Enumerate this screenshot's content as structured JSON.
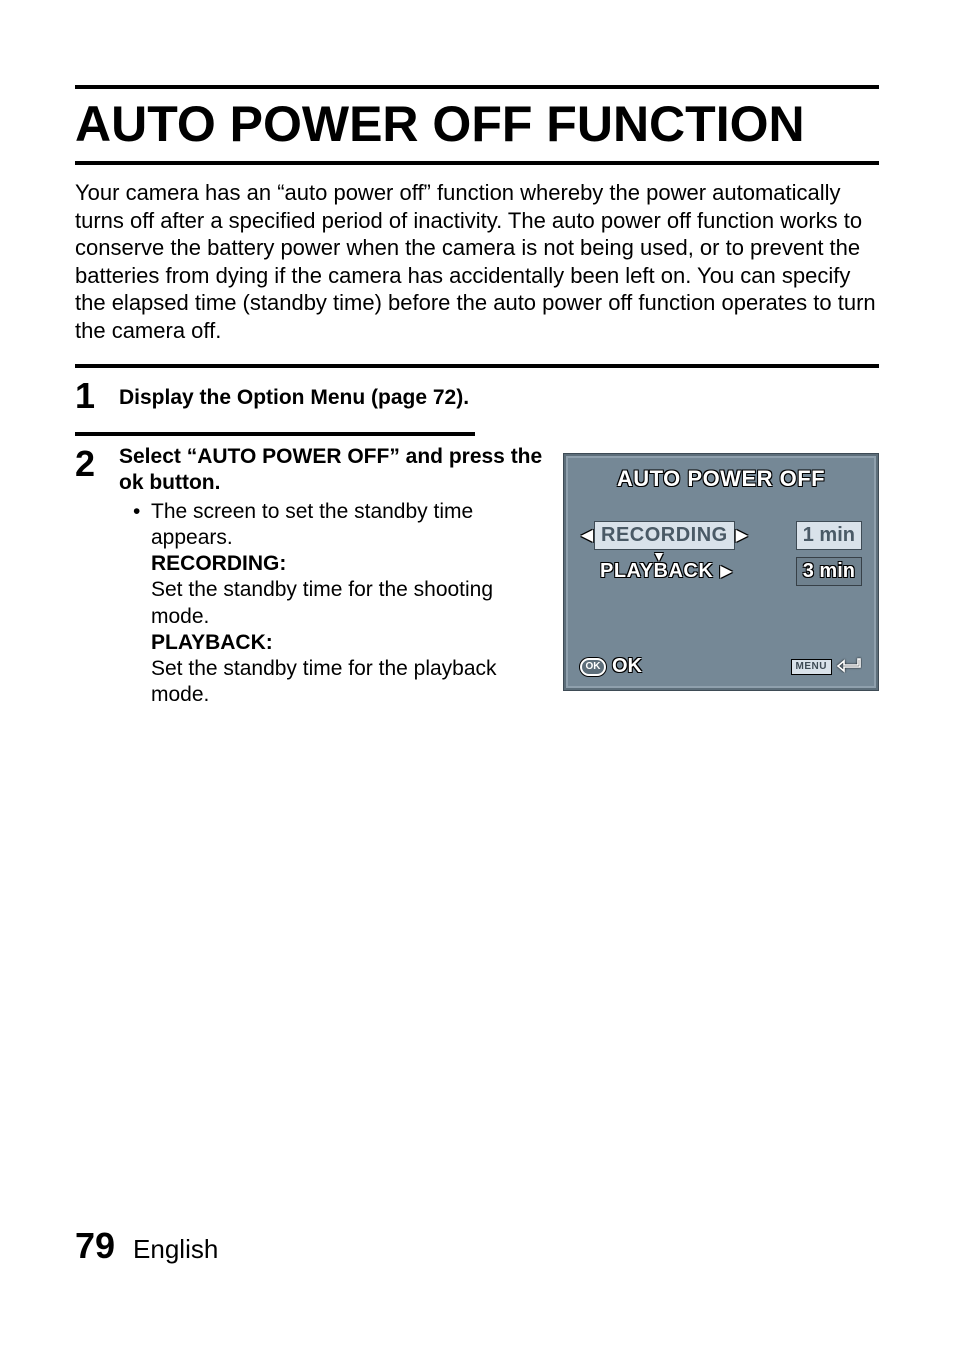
{
  "title": "AUTO POWER OFF FUNCTION",
  "intro": "Your camera has an “auto power off” function whereby the power automatically turns off after a specified period of inactivity. The auto power off function works to conserve the battery power when the camera is not being used, or to prevent the batteries from dying if the camera has accidentally been left on. You can specify the elapsed time (standby time) before the auto power off function operates to turn the camera off.",
  "steps": {
    "1": {
      "num": "1",
      "body": "Display the Option Menu (page 72)."
    },
    "2": {
      "num": "2",
      "head": "Select “AUTO POWER OFF” and press the ok button.",
      "bullet": "The screen to set the standby time appears.",
      "recording_label": "RECORDING:",
      "recording_desc": "Set the standby time for the shooting mode.",
      "playback_label": "PLAYBACK:",
      "playback_desc": "Set the standby time for the playback mode."
    }
  },
  "lcd": {
    "title": "AUTO POWER OFF",
    "rows": {
      "recording": {
        "label": "RECORDING",
        "value": "1 min"
      },
      "playback": {
        "label": "PLAYBACK",
        "value": "3 min"
      }
    },
    "footer": {
      "ok_small": "OK",
      "ok_text": "OK",
      "menu": "MENU"
    }
  },
  "footer": {
    "page": "79",
    "lang": "English"
  }
}
